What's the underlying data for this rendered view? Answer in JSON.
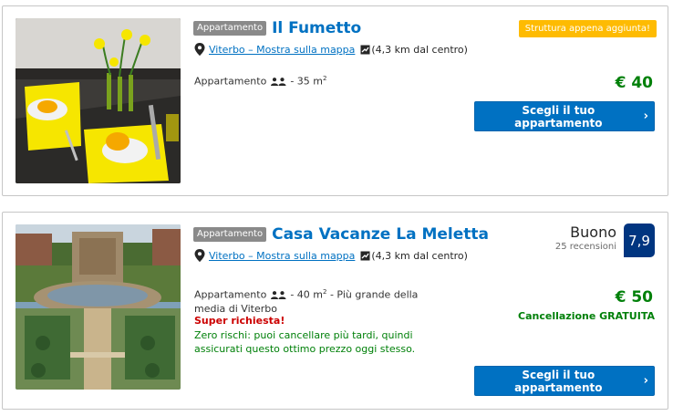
{
  "listings": [
    {
      "type_badge": "Appartamento",
      "name": "Il Fumetto",
      "location_link": "Viterbo – Mostra sulla mappa",
      "distance": "(4,3 km dal centro)",
      "unit_type": "Appartamento",
      "size_text": "- 35 m",
      "sup": "2",
      "new_badge": "Struttura appena aggiunta!",
      "price": "€ 40",
      "cta_label": "Scegli il tuo appartamento",
      "cta_chevron": "›"
    },
    {
      "type_badge": "Appartamento",
      "name": "Casa Vacanze La Meletta",
      "location_link": "Viterbo – Mostra sulla mappa",
      "distance": "(4,3 km dal centro)",
      "unit_type": "Appartamento",
      "size_text": "- 40 m",
      "sup": "2",
      "size_tail": "- Più grande della media di Viterbo",
      "high_demand": "Super richiesta!",
      "risk_note": "Zero rischi: puoi cancellare più tardi, quindi assicurati questo ottimo prezzo oggi stesso.",
      "score_word": "Buono",
      "reviews": "25 recensioni",
      "score": "7,9",
      "price": "€ 50",
      "free_cancel": "Cancellazione GRATUITA",
      "cta_label": "Scegli il tuo appartamento",
      "cta_chevron": "›"
    }
  ],
  "icons": {
    "pin": "map-pin-icon",
    "distance": "distance-icon",
    "occupancy": "two-people-icon"
  },
  "colors": {
    "link_blue": "#0071c2",
    "price_green": "#008009",
    "badge_yellow": "#febb02",
    "score_navy": "#003580",
    "alert_red": "#cc0000"
  }
}
